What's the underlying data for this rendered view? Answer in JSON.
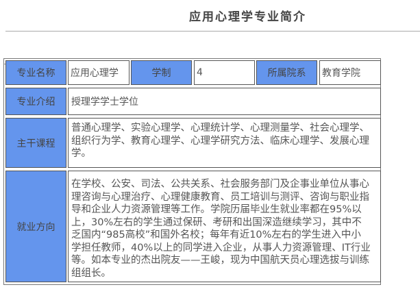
{
  "title": "应用心理学专业简介",
  "row1": {
    "name_label": "专业名称",
    "name_value": "应用心理学",
    "duration_label": "学制",
    "duration_value": "4",
    "dept_label": "所属院系",
    "dept_value": "教育学院"
  },
  "intro": {
    "label": "专业介绍",
    "value": "授理学学士学位"
  },
  "courses": {
    "label": "主干课程",
    "value": "普通心理学、实验心理学、心理统计学、心理测量学、社会心理学、组织行为学、教育心理学、心理学研究方法、临床心理学、发展心理学。"
  },
  "career": {
    "label": "就业方向",
    "value": "在学校、公安、司法、公共关系、社会服务部门及企事业单位从事心理咨询与心理治疗、心理健康教育、员工培训与测评、咨询与职业指导和企业人力资源管理等工作。学院历届毕业生就业率都在95%以上，30%左右的学生通过保研、考研和出国深造继续学习，其中不乏国内“985高校”和国外名校；每年有近10%左右的学生进入中小学担任教师，40%以上的同学进入企业，从事人力资源管理、IT行业等。如本专业的杰出院友——王峻，现为中国航天员心理选拔与训练组组长。"
  },
  "colors": {
    "label_bg": "#6495ed"
  }
}
